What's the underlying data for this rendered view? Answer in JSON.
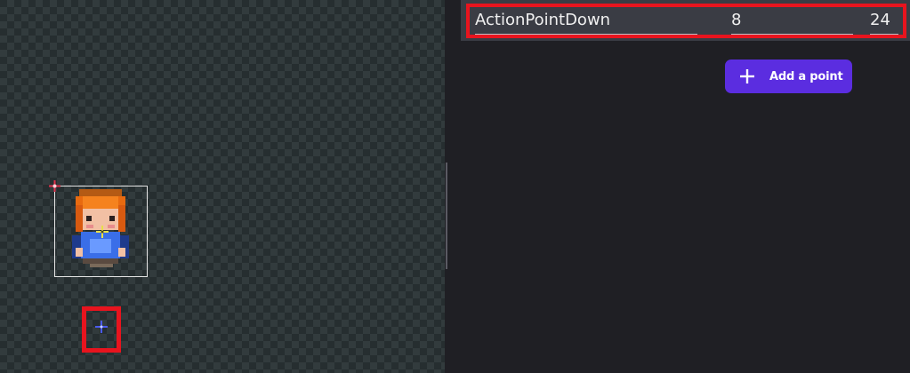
{
  "point": {
    "name": "ActionPointDown",
    "x": "8",
    "y": "24"
  },
  "add_point_button": {
    "label": "Add a point",
    "icon": "plus-icon"
  },
  "colors": {
    "accent": "#5b2de0",
    "highlight": "#e8141e",
    "origin_marker": "#e0304a",
    "center_marker": "#e8e04a",
    "point_marker": "#4a5af0"
  }
}
